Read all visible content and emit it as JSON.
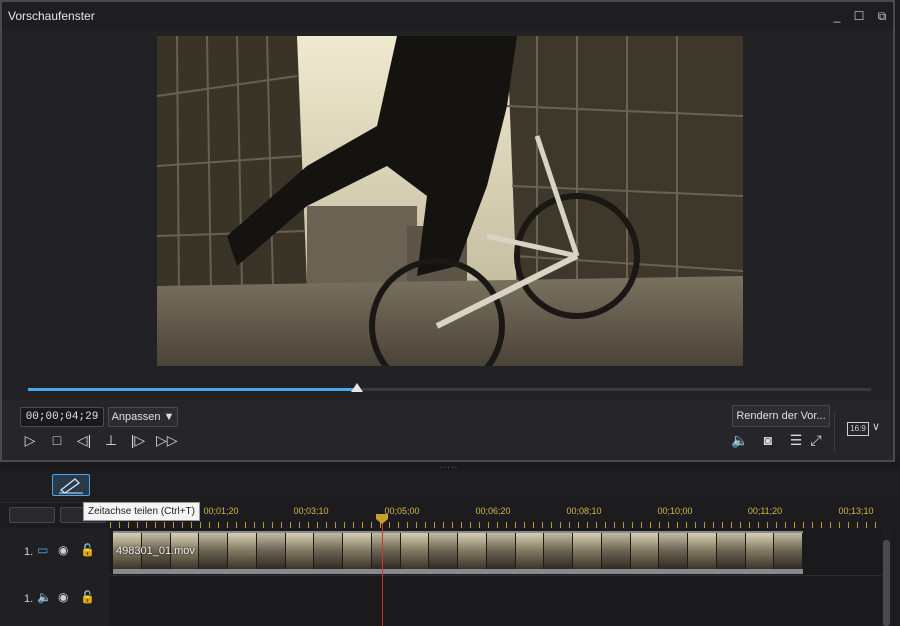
{
  "preview": {
    "title": "Vorschaufenster",
    "timecode": "00;00;04;29",
    "fit_label": "Anpassen ▼",
    "render_label": "Rendern der Vor...",
    "aspect_label": "16:9",
    "playback_progress_fraction": 0.39,
    "controls": [
      "play-icon",
      "stop-icon",
      "prev-frame-icon",
      "mark-icon",
      "next-frame-icon",
      "fast-forward-icon"
    ],
    "right_controls": [
      "volume-icon",
      "snapshot-icon",
      "subtitle-icon",
      "fullscreen-icon"
    ]
  },
  "timeline": {
    "tooltip": "Zeitachse teilen (Ctrl+T)",
    "ruler_labels": [
      "00;01;20",
      "00;03;10",
      "00;05;00",
      "00;06;20",
      "00;08;10",
      "00;10;00",
      "00;11;20",
      "00;13;10"
    ],
    "tracks": [
      {
        "number": "1.",
        "type": "video",
        "clip": "498301_01.mov"
      },
      {
        "number": "1.",
        "type": "audio",
        "clip": ""
      }
    ]
  },
  "colors": {
    "accent": "#4aa7e8",
    "playhead": "#d63030",
    "ruler": "#d4b64a"
  }
}
